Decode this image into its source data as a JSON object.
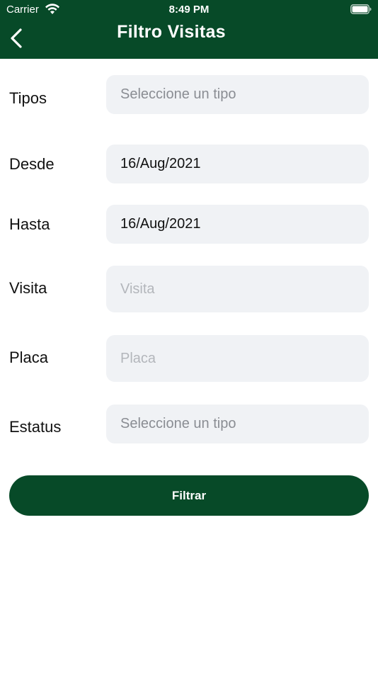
{
  "status_bar": {
    "carrier": "Carrier",
    "time": "8:49 PM"
  },
  "header": {
    "title": "Filtro Visitas",
    "back_icon": "chevron-left-icon",
    "background_color": "#074a28"
  },
  "form": {
    "tipos": {
      "label": "Tipos",
      "placeholder": "Seleccione  un tipo"
    },
    "desde": {
      "label": "Desde",
      "value": "16/Aug/2021"
    },
    "hasta": {
      "label": "Hasta",
      "value": "16/Aug/2021"
    },
    "visita": {
      "label": "Visita",
      "placeholder": "Visita"
    },
    "placa": {
      "label": "Placa",
      "placeholder": "Placa"
    },
    "estatus": {
      "label": "Estatus",
      "placeholder": "Seleccione  un tipo"
    }
  },
  "actions": {
    "filter_label": "Filtrar",
    "button_color": "#074a28"
  }
}
